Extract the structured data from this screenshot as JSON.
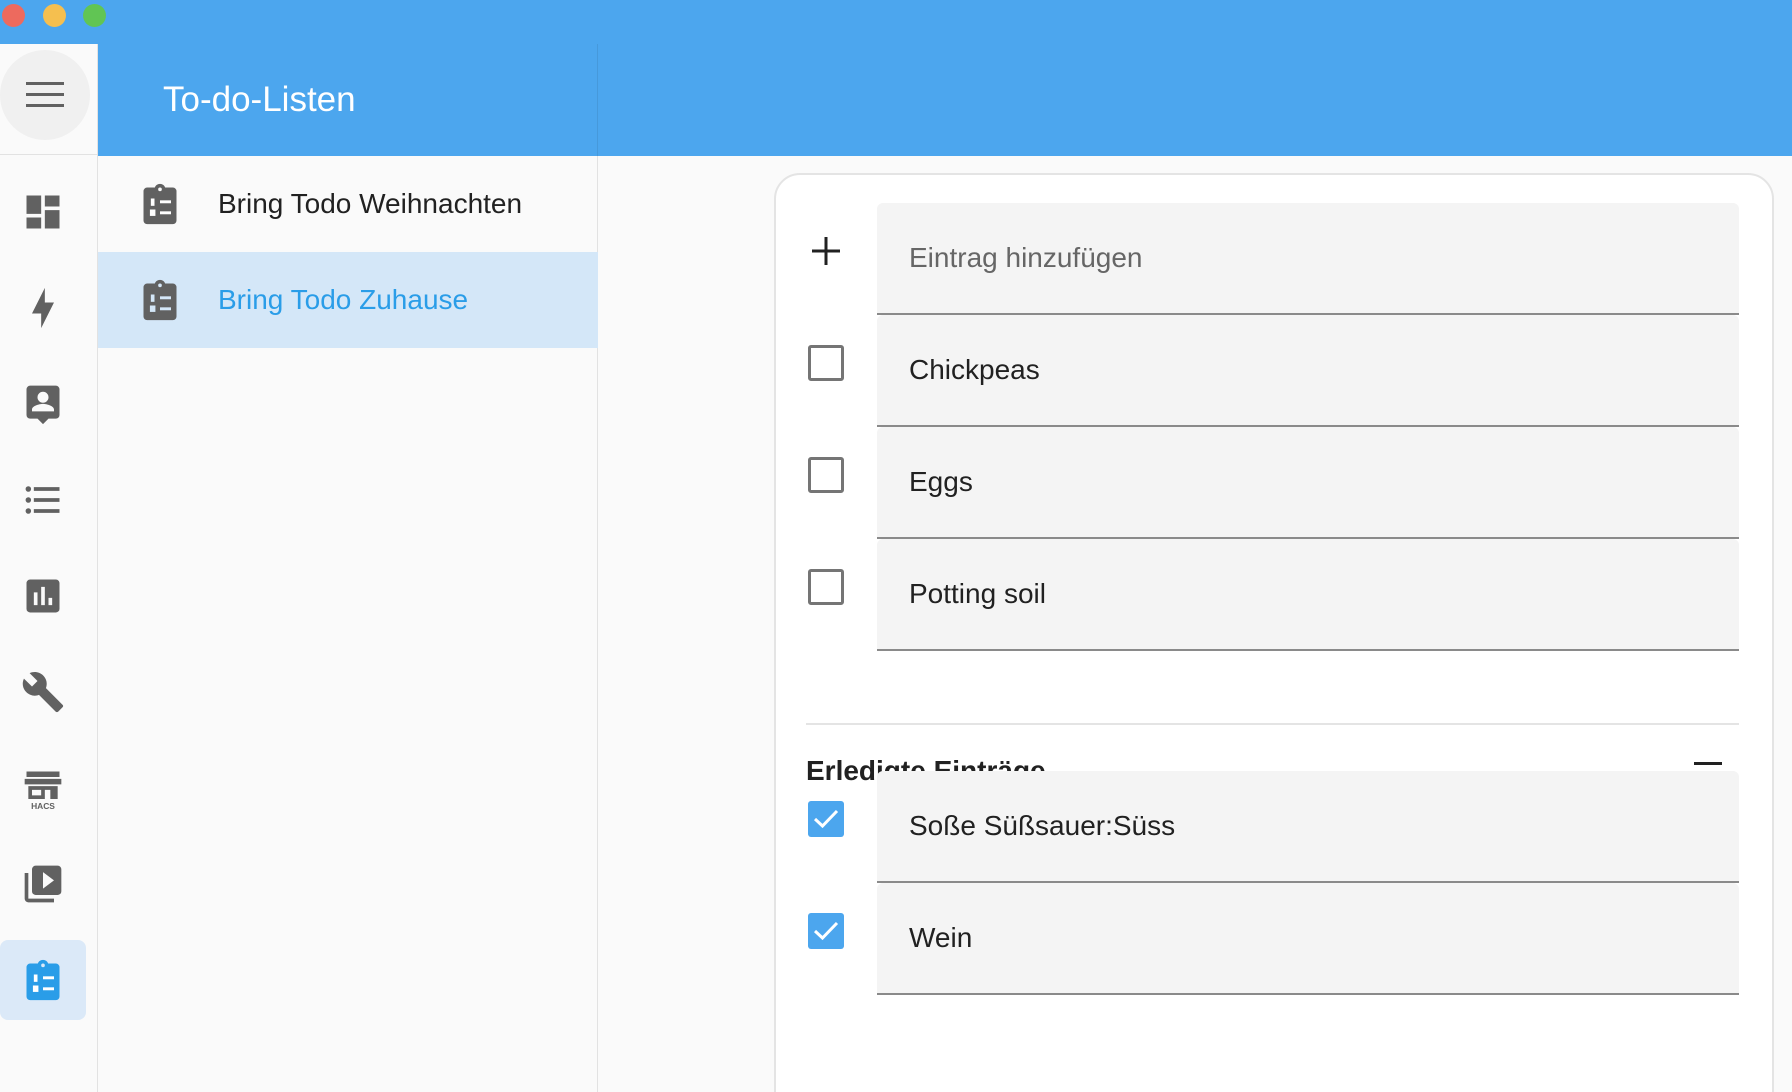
{
  "window": {
    "controls": [
      "close",
      "minimize",
      "maximize"
    ]
  },
  "colors": {
    "primary": "#4ca6ee",
    "active_text": "#2a9de8",
    "active_bg": "#d4e7f8",
    "icon": "#616161"
  },
  "header": {
    "title": "To-do-Listen"
  },
  "sidebar": {
    "menu_icon": "hamburger-menu-icon",
    "items": [
      {
        "name": "overview",
        "icon": "dashboard-icon",
        "active": false
      },
      {
        "name": "energy",
        "icon": "lightning-bolt-icon",
        "active": false
      },
      {
        "name": "map",
        "icon": "account-box-icon",
        "active": false
      },
      {
        "name": "logbook",
        "icon": "format-list-bulleted-icon",
        "active": false
      },
      {
        "name": "history",
        "icon": "chart-box-icon",
        "active": false
      },
      {
        "name": "developer-tools",
        "icon": "wrench-icon",
        "active": false
      },
      {
        "name": "hacs",
        "icon": "hacs-store-icon",
        "label": "HACS",
        "active": false
      },
      {
        "name": "media",
        "icon": "play-box-multiple-icon",
        "active": false
      },
      {
        "name": "todo",
        "icon": "clipboard-list-icon",
        "active": true
      }
    ]
  },
  "lists": [
    {
      "label": "Bring Todo Weihnachten",
      "icon": "clipboard-list-icon",
      "active": false
    },
    {
      "label": "Bring Todo Zuhause",
      "icon": "clipboard-list-icon",
      "active": true
    }
  ],
  "add_item": {
    "placeholder": "Eintrag hinzufügen",
    "icon": "plus-icon"
  },
  "open_items": [
    {
      "label": "Chickpeas",
      "checked": false
    },
    {
      "label": "Eggs",
      "checked": false
    },
    {
      "label": "Potting soil",
      "checked": false
    }
  ],
  "completed_section": {
    "title": "Erledigte Einträge",
    "sort_icon": "sort-icon"
  },
  "completed_items": [
    {
      "label": "Soße Süßsauer:Süss",
      "checked": true
    },
    {
      "label": "Wein",
      "checked": true
    }
  ]
}
